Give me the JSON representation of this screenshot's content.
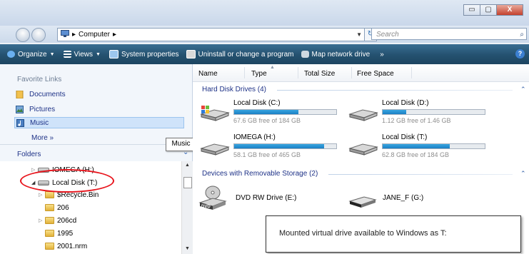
{
  "window": {
    "caption_buttons": [
      "▭",
      "▢",
      "X"
    ]
  },
  "address": {
    "path": [
      "Computer"
    ],
    "search_placeholder": "Search"
  },
  "command_bar": {
    "items": [
      {
        "label": "Organize",
        "icon": "organize-icon",
        "dropdown": true
      },
      {
        "label": "Views",
        "icon": "views-icon",
        "dropdown": true
      },
      {
        "label": "System properties",
        "icon": "system-properties-icon"
      },
      {
        "label": "Uninstall or change a program",
        "icon": "uninstall-icon"
      },
      {
        "label": "Map network drive",
        "icon": "map-drive-icon"
      }
    ],
    "overflow": "»"
  },
  "nav": {
    "favorites_header": "Favorite Links",
    "favorites": [
      {
        "label": "Documents",
        "icon": "documents-icon"
      },
      {
        "label": "Pictures",
        "icon": "pictures-icon"
      },
      {
        "label": "Music",
        "icon": "music-icon",
        "selected": true
      }
    ],
    "more": "More  »",
    "folders_header": "Folders",
    "tree": [
      {
        "label": "IOMEGA (H:)",
        "type": "drive",
        "level": 0,
        "expand": "collapsed"
      },
      {
        "label": "Local Disk (T:)",
        "type": "drive",
        "level": 0,
        "expand": "expanded"
      },
      {
        "label": "$Recycle.Bin",
        "type": "folder",
        "level": 1,
        "expand": "collapsed"
      },
      {
        "label": "206",
        "type": "folder",
        "level": 1,
        "expand": "none"
      },
      {
        "label": "206cd",
        "type": "folder",
        "level": 1,
        "expand": "collapsed"
      },
      {
        "label": "1995",
        "type": "folder",
        "level": 1,
        "expand": "none"
      },
      {
        "label": "2001.nrm",
        "type": "folder",
        "level": 1,
        "expand": "none"
      }
    ],
    "tooltip": "Music"
  },
  "columns": [
    "Name",
    "Type",
    "Total Size",
    "Free Space"
  ],
  "groups": {
    "hdd": {
      "label": "Hard Disk Drives (4)"
    },
    "removable": {
      "label": "Devices with Removable Storage (2)"
    }
  },
  "drives": [
    {
      "name": "Local Disk (C:)",
      "free": "67.6 GB free of 184 GB",
      "used_fraction": 0.63
    },
    {
      "name": "Local Disk (D:)",
      "free": "1.12 GB free of 1.46 GB",
      "used_fraction": 0.23
    },
    {
      "name": "IOMEGA (H:)",
      "free": "58.1 GB free of 465 GB",
      "used_fraction": 0.88
    },
    {
      "name": "Local Disk (T:)",
      "free": "62.8 GB free of 184 GB",
      "used_fraction": 0.66
    }
  ],
  "removable": [
    {
      "name": "DVD RW Drive (E:)",
      "icon": "dvd-drive-icon",
      "badge": "DVD"
    },
    {
      "name": "JANE_F (G:)",
      "icon": "usb-drive-icon"
    }
  ],
  "callout": "Mounted virtual drive available to Windows as T:"
}
